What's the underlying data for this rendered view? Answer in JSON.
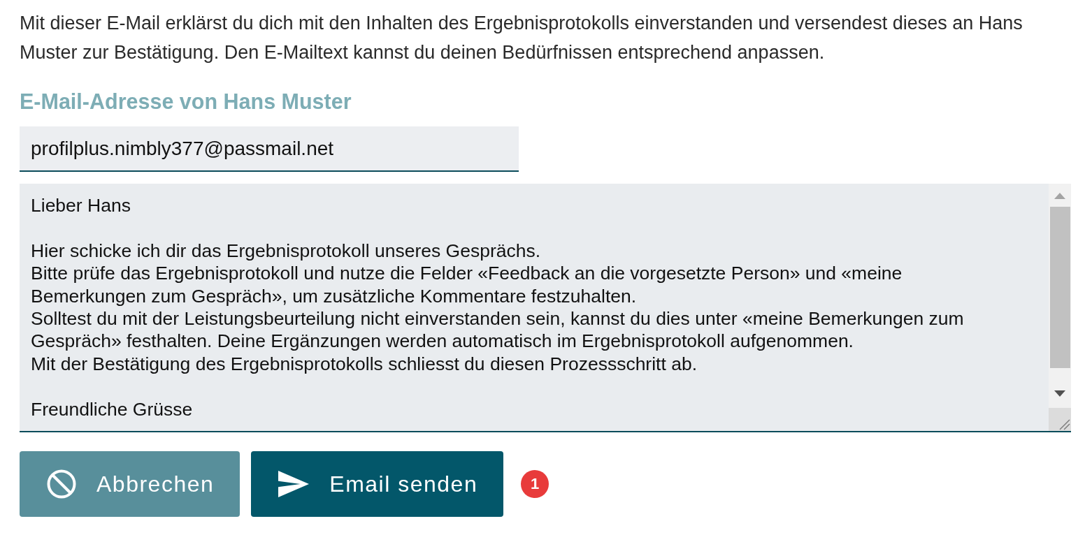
{
  "intro": "Mit dieser E-Mail erklärst du dich mit den Inhalten des Ergebnisprotokolls einverstanden und versendest dieses an Hans Muster zur Bestätigung. Den E-Mailtext kannst du deinen Bedürfnissen entsprechend anpassen.",
  "email_field": {
    "label": "E-Mail-Adresse von Hans Muster",
    "value": "profilplus.nimbly377@passmail.net"
  },
  "message": {
    "value": "Lieber Hans\n\nHier schicke ich dir das Ergebnisprotokoll unseres Gesprächs.\nBitte prüfe das Ergebnisprotokoll und nutze die Felder «Feedback an die vorgesetzte Person» und «meine Bemerkungen zum Gespräch», um zusätzliche Kommentare festzuhalten.\nSolltest du mit der Leistungsbeurteilung nicht einverstanden sein, kannst du dies unter «meine Bemerkungen zum Gespräch» festhalten. Deine Ergänzungen werden automatisch im Ergebnisprotokoll aufgenommen.\nMit der Bestätigung des Ergebnisprotokolls schliesst du diesen Prozessschritt ab.\n\nFreundliche Grüsse"
  },
  "buttons": [
    {
      "kind": "cancel",
      "label": "Abbrechen"
    },
    {
      "kind": "send",
      "label": "Email senden"
    }
  ],
  "badge": "1"
}
